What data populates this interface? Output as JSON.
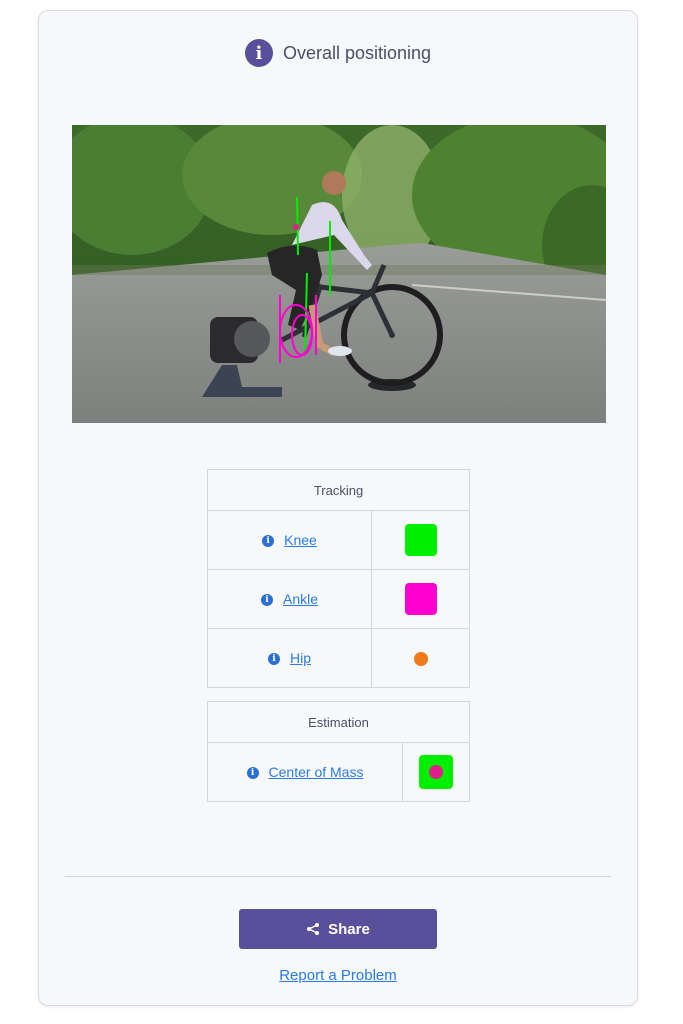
{
  "header": {
    "title": "Overall positioning",
    "icon": "info-icon"
  },
  "tracking": {
    "heading": "Tracking",
    "items": [
      {
        "label": "Knee",
        "swatch": "square",
        "color": "#00ee00"
      },
      {
        "label": "Ankle",
        "swatch": "square",
        "color": "#ff00d0"
      },
      {
        "label": "Hip",
        "swatch": "dot",
        "color": "#f07a1a"
      }
    ]
  },
  "estimation": {
    "heading": "Estimation",
    "items": [
      {
        "label": "Center of Mass",
        "outer_color": "#00ee00",
        "inner_color": "#e0208a"
      }
    ]
  },
  "actions": {
    "share_label": "Share",
    "report_label": "Report a Problem"
  },
  "colors": {
    "accent": "#5a4f9a",
    "link": "#2a7ae8"
  }
}
